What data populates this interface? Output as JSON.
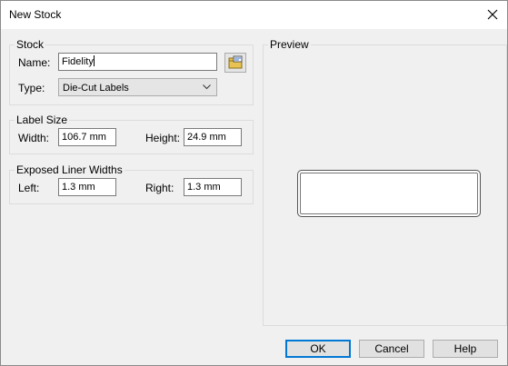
{
  "window": {
    "title": "New Stock"
  },
  "stock": {
    "legend": "Stock",
    "name_label": "Name:",
    "name_value": "Fidelity",
    "type_label": "Type:",
    "type_value": "Die-Cut Labels"
  },
  "label_size": {
    "legend": "Label Size",
    "width_label": "Width:",
    "width_value": "106.7 mm",
    "height_label": "Height:",
    "height_value": "24.9 mm"
  },
  "liner": {
    "legend": "Exposed Liner Widths",
    "left_label": "Left:",
    "left_value": "1.3 mm",
    "right_label": "Right:",
    "right_value": "1.3 mm"
  },
  "preview": {
    "legend": "Preview"
  },
  "buttons": {
    "ok": "OK",
    "cancel": "Cancel",
    "help": "Help"
  },
  "colors": {
    "accent": "#0078d7",
    "panel": "#f0f0f0"
  },
  "icons": {
    "browse": "browse-folder-icon",
    "close": "close-icon",
    "dropdown": "chevron-down-icon"
  }
}
